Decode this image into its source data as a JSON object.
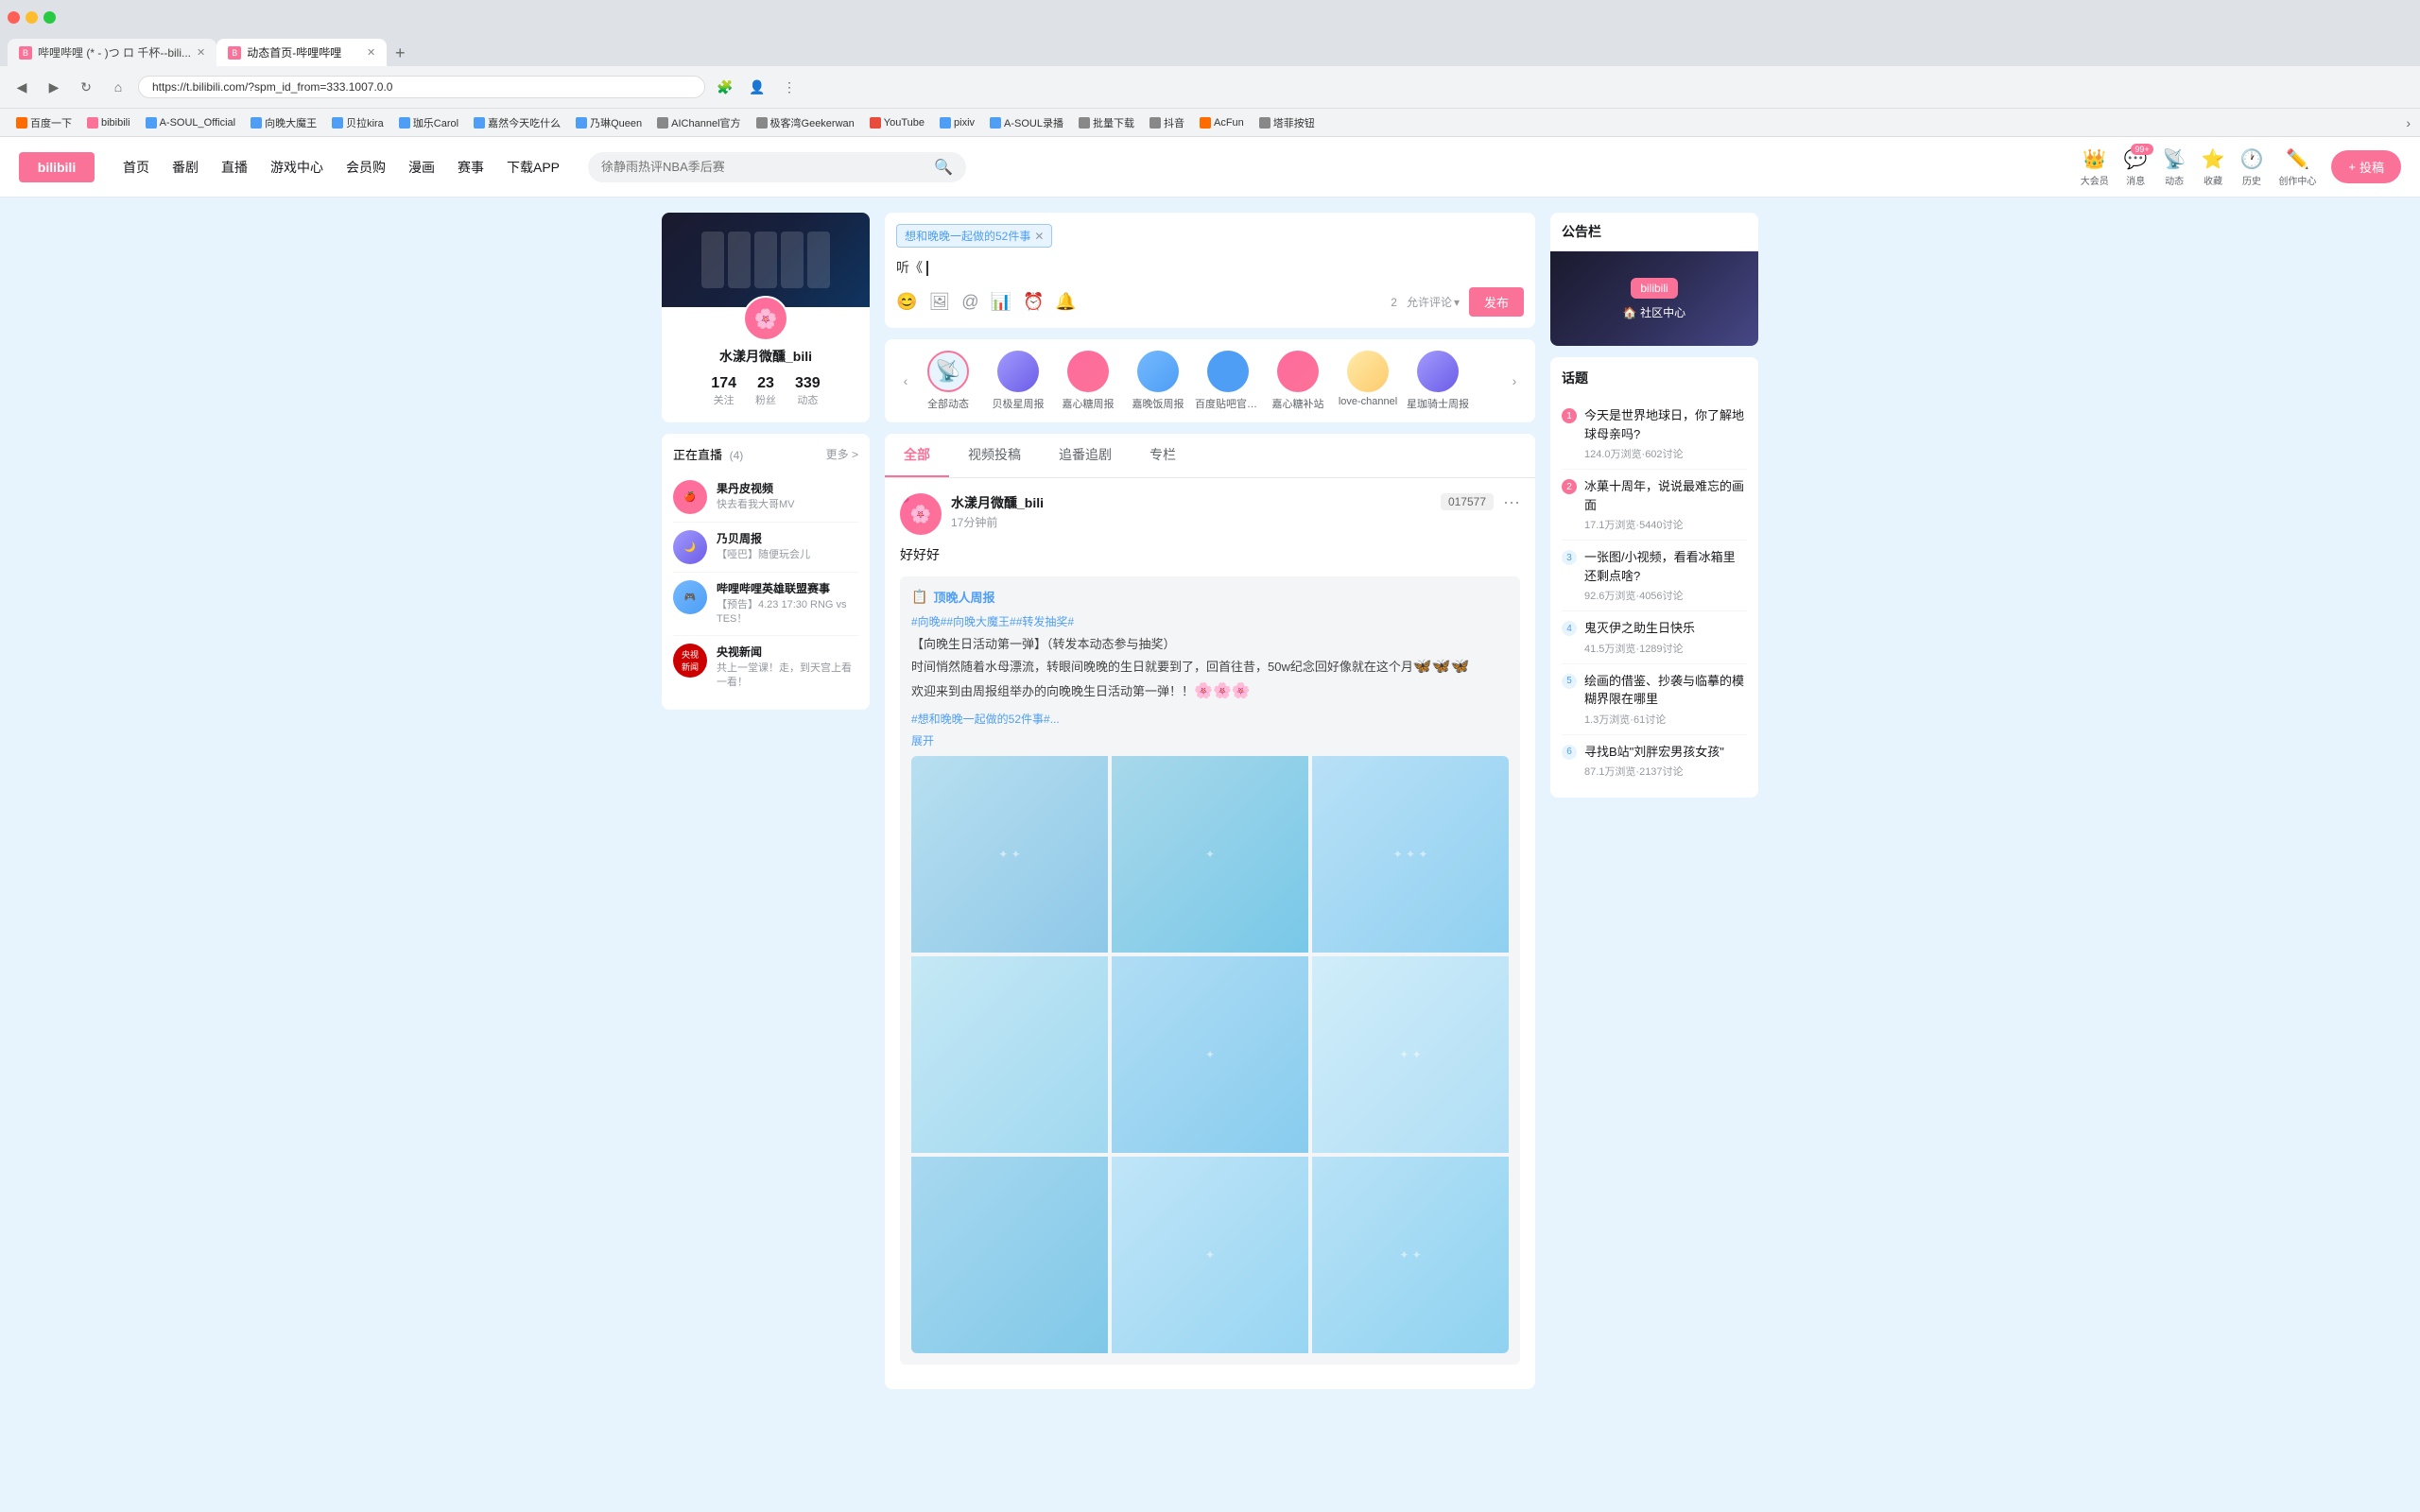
{
  "browser": {
    "tabs": [
      {
        "label": "哔哩哔哩 (* - )つ ロ 千杯--bili...",
        "active": false,
        "favicon": "B"
      },
      {
        "label": "动态首页-哔哩哔哩",
        "active": true,
        "favicon": "B"
      }
    ],
    "url": "https://t.bilibili.com/?spm_id_from=333.1007.0.0",
    "nav_back": "◀",
    "nav_forward": "▶",
    "nav_refresh": "↻",
    "nav_home": "⌂"
  },
  "bookmarks": [
    {
      "label": "百度一下",
      "color": "bk-orange"
    },
    {
      "label": "bibibili",
      "color": "bk-pink"
    },
    {
      "label": "A-SOUL_Official",
      "color": "bk-blue"
    },
    {
      "label": "向晚大魔王",
      "color": "bk-blue"
    },
    {
      "label": "贝拉kira",
      "color": "bk-blue"
    },
    {
      "label": "珈乐Carol",
      "color": "bk-blue"
    },
    {
      "label": "嘉然今天吃什么",
      "color": "bk-blue"
    },
    {
      "label": "乃琳Queen",
      "color": "bk-blue"
    },
    {
      "label": "AIChannel官方",
      "color": "bk-gray"
    },
    {
      "label": "极客湾Geekerwan",
      "color": "bk-gray"
    },
    {
      "label": "YouTube",
      "color": "bk-red"
    },
    {
      "label": "pixiv",
      "color": "bk-blue"
    },
    {
      "label": "A-SOUL录播",
      "color": "bk-blue"
    },
    {
      "label": "批量下载",
      "color": "bk-gray"
    },
    {
      "label": "抖音",
      "color": "bk-gray"
    },
    {
      "label": "AcFun",
      "color": "bk-orange"
    },
    {
      "label": "塔菲按钮",
      "color": "bk-gray"
    }
  ],
  "header": {
    "logo": "bilibili",
    "nav_items": [
      "首页",
      "番剧",
      "直播",
      "游戏中心",
      "会员购",
      "漫画",
      "赛事",
      "下载APP"
    ],
    "search_placeholder": "徐静雨热评NBA季后赛",
    "actions": {
      "da_hui_yuan": "大会员",
      "xiao_xi": "消息",
      "dong_tai": "动态",
      "shou_cang": "收藏",
      "li_shi": "历史",
      "chuang_zuo_zhong_xin": "创作中心",
      "upload_label": "投稿",
      "message_badge": "99+"
    }
  },
  "left_sidebar": {
    "profile": {
      "name": "水漾月微醺_bili",
      "stats": [
        {
          "num": "174",
          "label": "关注"
        },
        {
          "num": "23",
          "label": "粉丝"
        },
        {
          "num": "339",
          "label": "动态"
        }
      ]
    },
    "live_section": {
      "title": "正在直播",
      "count": "(4)",
      "more": "更多 >",
      "items": [
        {
          "name": "果丹皮视频",
          "desc": "快去看我大哥MV",
          "avatar_color": "av-pink"
        },
        {
          "name": "乃贝周报",
          "desc": "【哑巴】随便玩会儿",
          "avatar_color": "av-purple"
        },
        {
          "name": "哔哩哔哩英雄联盟赛事",
          "desc": "【预告】4.23 17:30 RNG vs TES！",
          "avatar_color": "av-blue"
        },
        {
          "name": "央视新闻",
          "desc": "共上一堂课！走，到天宫上看一看！",
          "avatar_color": "av-cctv"
        }
      ]
    }
  },
  "post_input": {
    "tag": "想和晚晚一起做的52件事",
    "placeholder_text": "听《",
    "char_count": "2",
    "permission": "允许评论",
    "publish": "发布",
    "icons": [
      "😊",
      "🖼",
      "@",
      "📊",
      "⏰",
      "🔔"
    ]
  },
  "subscriptions": {
    "items": [
      {
        "name": "全部动态",
        "type": "all",
        "active": true
      },
      {
        "name": "贝极星周报",
        "type": "avatar"
      },
      {
        "name": "嘉心糖周报",
        "type": "avatar"
      },
      {
        "name": "嘉晚饭周报",
        "type": "avatar"
      },
      {
        "name": "百度贴吧官方号",
        "type": "avatar"
      },
      {
        "name": "嘉心糖补站",
        "type": "avatar"
      },
      {
        "name": "love-channel",
        "type": "avatar"
      },
      {
        "name": "星珈骑士周报",
        "type": "avatar"
      }
    ]
  },
  "feed_tabs": [
    "全部",
    "视频投稿",
    "追番追剧",
    "专栏"
  ],
  "post": {
    "username": "水漾月微醺_bili",
    "time": "17分钟前",
    "id_badge": "017577",
    "content": "好好好",
    "repost": {
      "source_name": "顶晚人周报",
      "tags": [
        "#向晚##向晚大魔王##转发抽奖#"
      ],
      "text": "【向晚生日活动第一弹】（转发本动态参与抽奖）\n时间悄然随着水母漂流，转眼间晚晚的生日就要到了，回首往昔，50w纪念回好像就在这个月\n欢迎来到由周报组举办的向晚晚生日活动第一弹！！",
      "tags2": [
        "#想和晚晚一起做的52件事#..."
      ],
      "expand": "展开"
    },
    "images": [
      9
    ]
  },
  "right_sidebar": {
    "announcement": {
      "title": "公告栏",
      "banner_text1": "bilibili",
      "banner_text2": "社区中心"
    },
    "topics": {
      "title": "话题",
      "items": [
        {
          "num": "1",
          "hot": true,
          "title": "今天是世界地球日，你了解地球母亲吗?",
          "stats": "124.0万浏览·602讨论"
        },
        {
          "num": "2",
          "hot": true,
          "title": "冰菓十周年，说说最难忘的画面",
          "stats": "17.1万浏览·5440讨论"
        },
        {
          "num": "3",
          "hot": false,
          "title": "一张图/小视频，看看冰箱里还剩点啥?",
          "stats": "92.6万浏览·4056讨论"
        },
        {
          "num": "4",
          "hot": false,
          "title": "鬼灭伊之助生日快乐",
          "stats": "41.5万浏览·1289讨论"
        },
        {
          "num": "5",
          "hot": false,
          "title": "绘画的借鉴、抄袭与临摹的模糊界限在哪里",
          "stats": "1.3万浏览·61讨论"
        },
        {
          "num": "6",
          "hot": false,
          "title": "寻找B站\"刘胖宏男孩女孩\"",
          "stats": "87.1万浏览·2137讨论"
        }
      ]
    }
  }
}
